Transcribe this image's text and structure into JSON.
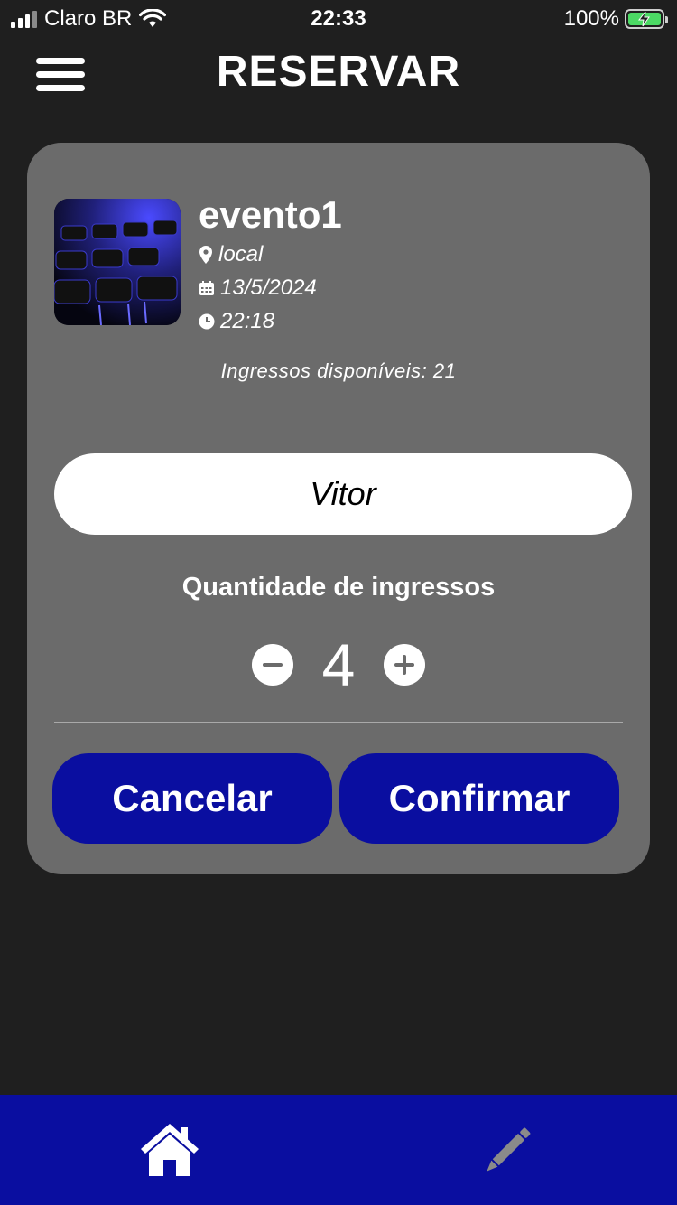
{
  "status_bar": {
    "carrier": "Claro BR",
    "time": "22:33",
    "battery_percent": "100%"
  },
  "header": {
    "title": "RESERVAR",
    "menu_icon": "hamburger-menu-icon"
  },
  "event": {
    "name": "evento1",
    "location": "local",
    "date": "13/5/2024",
    "time": "22:18",
    "available_tickets": "Ingressos disponíveis: 21",
    "icons": {
      "location": "map-pin-icon",
      "date": "calendar-icon",
      "time": "clock-icon"
    }
  },
  "form": {
    "name_value": "Vitor",
    "quantity_label": "Quantidade de ingressos",
    "quantity_value": "4"
  },
  "actions": {
    "cancel_label": "Cancelar",
    "confirm_label": "Confirmar"
  },
  "bottom_nav": {
    "items": [
      {
        "icon": "home-icon",
        "active": true
      },
      {
        "icon": "pencil-icon",
        "active": false
      }
    ]
  },
  "colors": {
    "background": "#1f1f1f",
    "card": "#6b6b6b",
    "accent": "#0a0ea0",
    "battery": "#4cd964"
  }
}
